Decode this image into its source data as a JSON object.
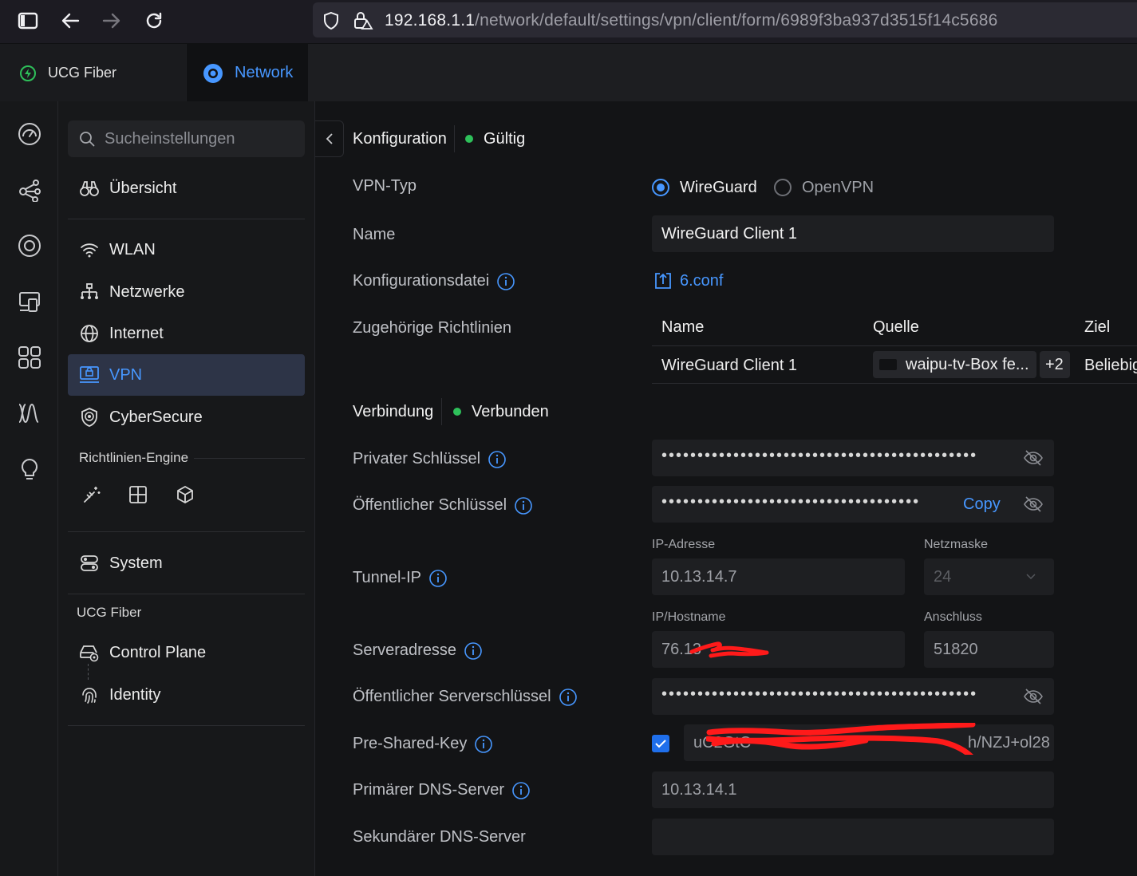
{
  "browser": {
    "url_host": "192.168.1.1",
    "url_path": "/network/default/settings/vpn/client/form/6989f3ba937d3515f14c5686"
  },
  "app_tabs": [
    {
      "label": "UCG Fiber",
      "icon": "bolt-circle-icon",
      "active": false
    },
    {
      "label": "Network",
      "icon": "network-ring-icon",
      "active": true
    }
  ],
  "sidebar": {
    "search_placeholder": "Sucheinstellungen",
    "items": [
      {
        "label": "Übersicht",
        "icon": "binoculars-icon"
      },
      {
        "label": "WLAN",
        "icon": "wifi-icon"
      },
      {
        "label": "Netzwerke",
        "icon": "network-tree-icon"
      },
      {
        "label": "Internet",
        "icon": "globe-icon"
      },
      {
        "label": "VPN",
        "icon": "vpn-icon",
        "active": true
      },
      {
        "label": "CyberSecure",
        "icon": "shield-icon"
      }
    ],
    "policy_engine_label": "Richtlinien-Engine",
    "system_label": "System",
    "device_section_label": "UCG Fiber",
    "device_items": [
      {
        "label": "Control Plane",
        "icon": "control-plane-icon"
      },
      {
        "label": "Identity",
        "icon": "fingerprint-icon"
      }
    ]
  },
  "form": {
    "config_title": "Konfiguration",
    "config_status": "Gültig",
    "vpn_type_label": "VPN-Typ",
    "vpn_type_options": [
      "WireGuard",
      "OpenVPN"
    ],
    "vpn_type_selected": "WireGuard",
    "name_label": "Name",
    "name_value": "WireGuard Client 1",
    "config_file_label": "Konfigurationsdatei",
    "config_file_value": "6.conf",
    "policies_label": "Zugehörige Richtlinien",
    "policies_table": {
      "headers": [
        "Name",
        "Quelle",
        "Ziel"
      ],
      "rows": [
        {
          "name": "WireGuard Client 1",
          "source": "waipu-tv-Box fe...",
          "source_extra": "+2",
          "target": "Beliebig"
        }
      ]
    },
    "connection_title": "Verbindung",
    "connection_status": "Verbunden",
    "private_key_label": "Privater Schlüssel",
    "private_key_mask": "••••••••••••••••••••••••••••••••••••••••••••",
    "public_key_label": "Öffentlicher Schlüssel",
    "public_key_mask": "••••••••••••••••••••••••••••••••••••",
    "copy_label": "Copy",
    "tunnel_ip_label": "Tunnel-IP",
    "ip_address_label": "IP-Adresse",
    "ip_address_value": "10.13.14.7",
    "netmask_label": "Netzmaske",
    "netmask_value": "24",
    "server_address_label": "Serveradresse",
    "hostname_label": "IP/Hostname",
    "hostname_value": "76.13",
    "port_label": "Anschluss",
    "port_value": "51820",
    "server_public_key_label": "Öffentlicher Serverschlüssel",
    "server_public_key_mask": "••••••••••••••••••••••••••••••••••••••••••••",
    "psk_label": "Pre-Shared-Key",
    "psk_enabled": true,
    "psk_value_start": "uC2GtC",
    "psk_value_end": "h/NZJ+ol28",
    "primary_dns_label": "Primärer DNS-Server",
    "primary_dns_value": "10.13.14.1",
    "secondary_dns_label": "Sekundärer DNS-Server",
    "secondary_dns_value": ""
  },
  "colors": {
    "accent": "#4797ff",
    "status_green": "#2ec05a",
    "redaction": "#ff1a1a"
  }
}
